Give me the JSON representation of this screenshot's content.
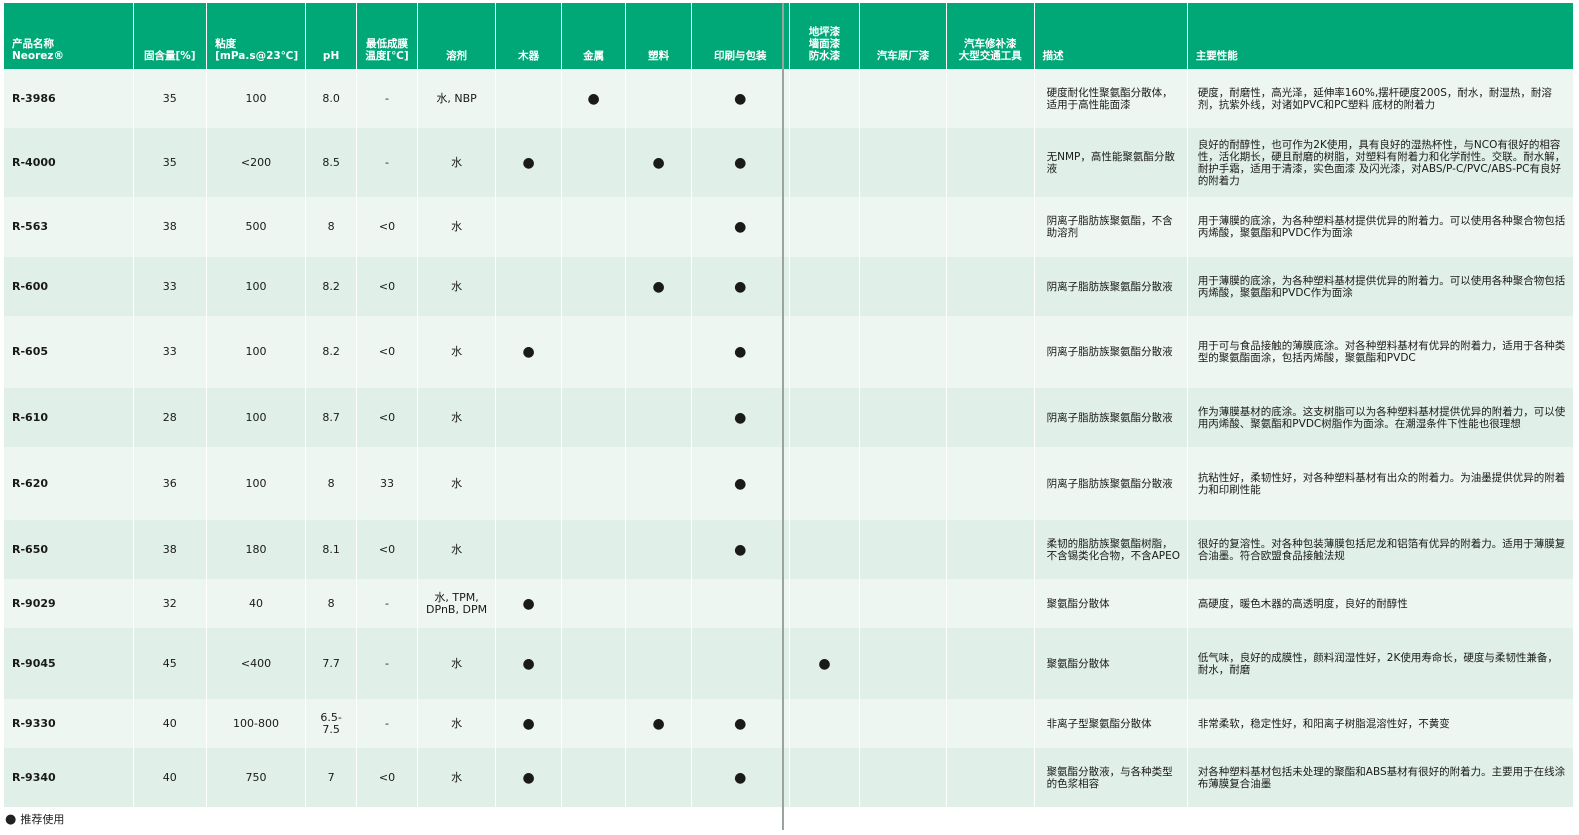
{
  "headers": {
    "name_line1": "产品名称",
    "name_line2": "Neorez®",
    "solids": "固含量[%]",
    "visc_line1": "粘度",
    "visc_line2": "[mPa.s@23℃]",
    "ph": "pH",
    "mfft_line1": "最低成膜",
    "mfft_line2": "温度[℃]",
    "solvent": "溶剂",
    "wood": "木器",
    "metal": "金属",
    "plastic": "塑料",
    "printing": "印刷与包装",
    "floor_line1": "地坪漆",
    "floor_line2": "墙面漆",
    "floor_line3": "防水漆",
    "oem": "汽车原厂漆",
    "refinish_line1": "汽车修补漆",
    "refinish_line2": "大型交通工具",
    "desc": "描述",
    "props": "主要性能"
  },
  "dot_symbol": "●",
  "rows": [
    {
      "name": "R-3986",
      "solids": "35",
      "visc": "100",
      "ph": "8.0",
      "mfft": "-",
      "solvent": "水, NBP",
      "wood": "",
      "metal": "●",
      "plastic": "",
      "printing": "●",
      "floor": "",
      "oem": "",
      "refinish": "",
      "desc": "硬度耐化性聚氨酯分散体，适用于高性能面漆",
      "props": "硬度，耐磨性，高光泽，延伸率160%,摆杆硬度200S，耐水，耐湿热，耐溶剂，抗紫外线，对诸如PVC和PC塑料 底材的附着力"
    },
    {
      "name": "R-4000",
      "solids": "35",
      "visc": "<200",
      "ph": "8.5",
      "mfft": "-",
      "solvent": "水",
      "wood": "●",
      "metal": "",
      "plastic": "●",
      "printing": "●",
      "floor": "",
      "oem": "",
      "refinish": "",
      "desc": "无NMP，高性能聚氨酯分散液",
      "props": "良好的耐醇性，也可作为2K使用，具有良好的湿热杯性，与NCO有很好的相容性，活化期长，硬且耐磨的树脂，对塑料有附着力和化学耐性。交联。耐水解，耐护手霜，适用于清漆，实色面漆 及闪光漆，对ABS/P-C/PVC/ABS-PC有良好的附着力"
    },
    {
      "name": "R-563",
      "solids": "38",
      "visc": "500",
      "ph": "8",
      "mfft": "<0",
      "solvent": "水",
      "wood": "",
      "metal": "",
      "plastic": "",
      "printing": "●",
      "floor": "",
      "oem": "",
      "refinish": "",
      "desc": "阴离子脂肪族聚氨酯，不含助溶剂",
      "props": "用于薄膜的底涂，为各种塑料基材提供优异的附着力。可以使用各种聚合物包括丙烯酸，聚氨酯和PVDC作为面涂"
    },
    {
      "name": "R-600",
      "solids": "33",
      "visc": "100",
      "ph": "8.2",
      "mfft": "<0",
      "solvent": "水",
      "wood": "",
      "metal": "",
      "plastic": "●",
      "printing": "●",
      "floor": "",
      "oem": "",
      "refinish": "",
      "desc": "阴离子脂肪族聚氨酯分散液",
      "props": "用于薄膜的底涂，为各种塑料基材提供优异的附着力。可以使用各种聚合物包括丙烯酸，聚氨酯和PVDC作为面涂"
    },
    {
      "name": "R-605",
      "solids": "33",
      "visc": "100",
      "ph": "8.2",
      "mfft": "<0",
      "solvent": "水",
      "wood": "●",
      "metal": "",
      "plastic": "",
      "printing": "●",
      "floor": "",
      "oem": "",
      "refinish": "",
      "desc": "阴离子脂肪族聚氨酯分散液",
      "props": "用于可与食品接触的薄膜底涂。对各种塑料基材有优异的附着力，适用于各种类型的聚氨酯面涂，包括丙烯酸，聚氨酯和PVDC"
    },
    {
      "name": "R-610",
      "solids": "28",
      "visc": "100",
      "ph": "8.7",
      "mfft": "<0",
      "solvent": "水",
      "wood": "",
      "metal": "",
      "plastic": "",
      "printing": "●",
      "floor": "",
      "oem": "",
      "refinish": "",
      "desc": "阴离子脂肪族聚氨酯分散液",
      "props": "作为薄膜基材的底涂。这支树脂可以为各种塑料基材提供优异的附着力，可以使用丙烯酸、聚氨酯和PVDC树脂作为面涂。在潮湿条件下性能也很理想"
    },
    {
      "name": "R-620",
      "solids": "36",
      "visc": "100",
      "ph": "8",
      "mfft": "33",
      "solvent": "水",
      "wood": "",
      "metal": "",
      "plastic": "",
      "printing": "●",
      "floor": "",
      "oem": "",
      "refinish": "",
      "desc": "阴离子脂肪族聚氨酯分散液",
      "props": "抗粘性好，柔韧性好，对各种塑料基材有出众的附着力。为油墨提供优异的附着力和印刷性能"
    },
    {
      "name": "R-650",
      "solids": "38",
      "visc": "180",
      "ph": "8.1",
      "mfft": "<0",
      "solvent": "水",
      "wood": "",
      "metal": "",
      "plastic": "",
      "printing": "●",
      "floor": "",
      "oem": "",
      "refinish": "",
      "desc": "柔韧的脂肪族聚氨酯树脂，不含锡类化合物，不含APEO",
      "props": "很好的复溶性。对各种包装薄膜包括尼龙和铝箔有优异的附着力。适用于薄膜复合油墨。符合欧盟食品接触法规"
    },
    {
      "name": "R-9029",
      "solids": "32",
      "visc": "40",
      "ph": "8",
      "mfft": "-",
      "solvent": "水, TPM, DPnB, DPM",
      "wood": "●",
      "metal": "",
      "plastic": "",
      "printing": "",
      "floor": "",
      "oem": "",
      "refinish": "",
      "desc": "聚氨酯分散体",
      "props": "高硬度，暖色木器的高透明度，良好的耐醇性"
    },
    {
      "name": "R-9045",
      "solids": "45",
      "visc": "<400",
      "ph": "7.7",
      "mfft": "-",
      "solvent": "水",
      "wood": "●",
      "metal": "",
      "plastic": "",
      "printing": "",
      "floor": "●",
      "oem": "",
      "refinish": "",
      "desc": "聚氨酯分散体",
      "props": "低气味，良好的成膜性，颜料润湿性好，2K使用寿命长，硬度与柔韧性兼备，耐水，耐磨"
    },
    {
      "name": "R-9330",
      "solids": "40",
      "visc": "100-800",
      "ph": "6.5-7.5",
      "mfft": "-",
      "solvent": "水",
      "wood": "●",
      "metal": "",
      "plastic": "●",
      "printing": "●",
      "floor": "",
      "oem": "",
      "refinish": "",
      "desc": "非离子型聚氨酯分散体",
      "props": "非常柔软，稳定性好，和阳离子树脂混溶性好，不黄变"
    },
    {
      "name": "R-9340",
      "solids": "40",
      "visc": "750",
      "ph": "7",
      "mfft": "<0",
      "solvent": "水",
      "wood": "●",
      "metal": "",
      "plastic": "",
      "printing": "●",
      "floor": "",
      "oem": "",
      "refinish": "",
      "desc": "聚氨酯分散液，与各种类型的色浆相容",
      "props": "对各种塑料基材包括未处理的聚酯和ABS基材有很好的附着力。主要用于在线涂布薄膜复合油墨"
    }
  ],
  "legend": "推荐使用"
}
